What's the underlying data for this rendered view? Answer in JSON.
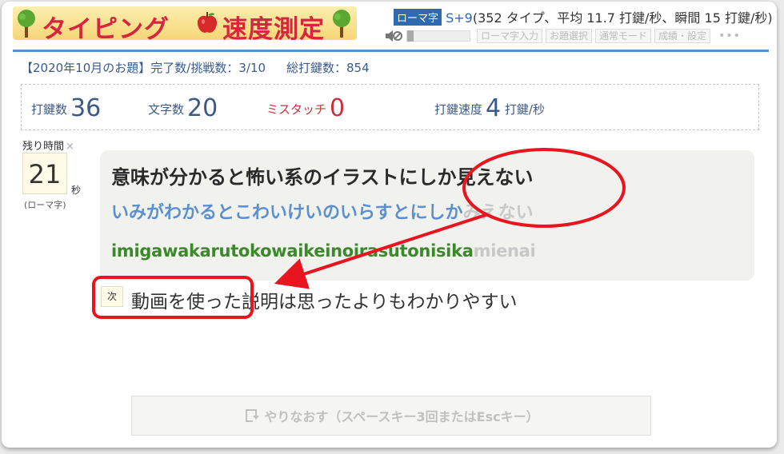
{
  "header": {
    "logo_left": "タイピング",
    "logo_right": "速度測定",
    "mode_badge": "ローマ字",
    "setting": "S+9",
    "setting_detail": "(352 タイプ、平均 11.7 打鍵/秒、瞬間 15 打鍵/秒)",
    "buttons": [
      "ローマ字入力",
      "お題選択",
      "通常モード",
      "成績・設定"
    ],
    "more": "•••"
  },
  "subinfo": {
    "theme": "【2020年10月のお題】完了数/挑戦数：3/10",
    "total": "総打鍵数：854"
  },
  "stats": {
    "keystrokes_label": "打鍵数",
    "keystrokes_value": "36",
    "chars_label": "文字数",
    "chars_value": "20",
    "miss_label": "ミスタッチ",
    "miss_value": "0",
    "speed_label": "打鍵速度",
    "speed_value": "4",
    "speed_unit": "打鍵/秒"
  },
  "timer": {
    "label": "残り時間",
    "close": "×",
    "value": "21",
    "unit": "秒",
    "mode": "(ローマ字)"
  },
  "question": {
    "kanji": "意味が分かると怖い系のイラストにしか見えない",
    "kana_done": "いみがわかるとこわいけいのいらすとにしか",
    "kana_rest": "みえない",
    "roma_done": "imigawakarutokowaikeinoirasutonisika",
    "roma_rest": "mienai"
  },
  "next": {
    "badge": "次",
    "text": "動画を使った説明は思ったよりもわかりやすい"
  },
  "retry": {
    "label": "やりなおす（スペースキー3回またはEscキー）"
  },
  "colors": {
    "accent_blue": "#2d6ab0",
    "typed_kana": "#5a8fd0",
    "typed_roma": "#3a8a2a",
    "miss_red": "#c8323a",
    "annotation_red": "#e8141e"
  }
}
